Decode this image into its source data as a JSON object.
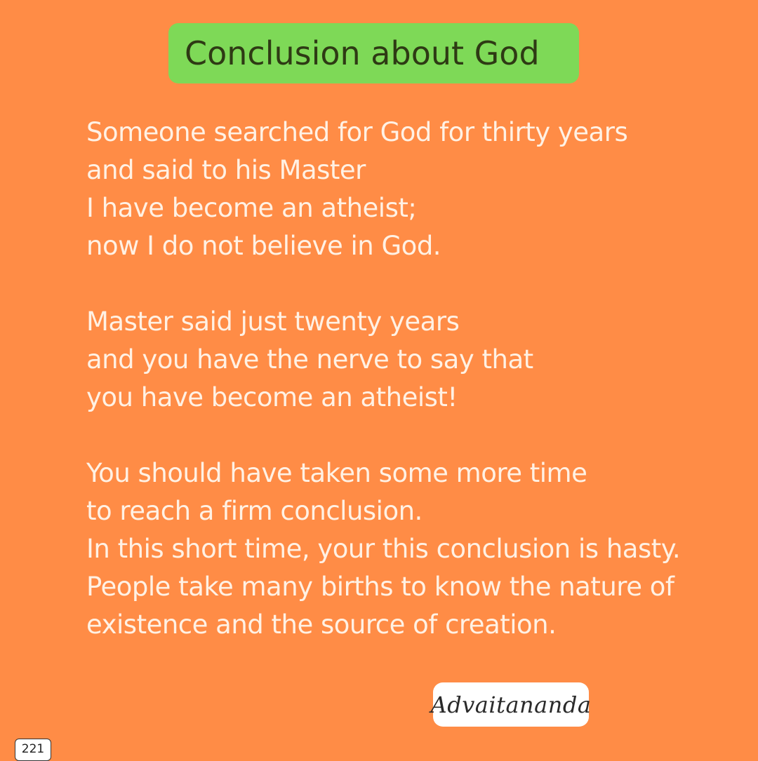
{
  "title": "Conclusion about God",
  "poem": {
    "stanzas": [
      {
        "lines": [
          "Someone searched for God for thirty years",
          "and said to his Master",
          "I have become an atheist;",
          "now I do not believe in God."
        ]
      },
      {
        "lines": [
          "Master said just twenty years",
          "and you have the nerve to say that",
          "you have become an atheist!"
        ]
      },
      {
        "lines": [
          "You should have taken some more time",
          "to reach a firm conclusion.",
          "In this short time, your this conclusion is hasty.",
          "People take many births to know the nature of",
          "existence and the source of creation."
        ]
      }
    ]
  },
  "signature": "Advaitananda",
  "page_number": "221",
  "colors": {
    "background": "#FF8C46",
    "title_box": "#7ED957",
    "title_text": "#2E3A14",
    "poem_text": "#FFF1E4",
    "signature_box": "#FFFFFF"
  }
}
